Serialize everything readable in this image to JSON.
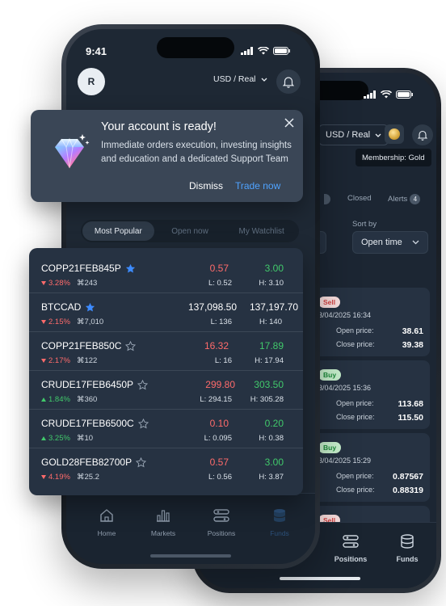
{
  "colors": {
    "accent": "#4fa3ff",
    "positive": "#41c96b",
    "negative": "#ff6b6b",
    "star_filled": "#3d8bff",
    "screen_bg": "#1e2834",
    "card_bg": "#263242"
  },
  "back_phone": {
    "account_selector": "USD / Real",
    "membership": "Membership: Gold",
    "tabs": [
      {
        "label": "Closed"
      },
      {
        "label": "Alerts",
        "count": "4"
      }
    ],
    "sort_label": "Sort by",
    "sort_value": "Open time",
    "positions": [
      {
        "side": "Sell",
        "date": "3/04/2025 16:34",
        "open_label": "Open price:",
        "open": "38.61",
        "close_label": "Close price:",
        "close": "39.38"
      },
      {
        "side": "Buy",
        "date": "3/04/2025 15:36",
        "open_label": "Open price:",
        "open": "113.68",
        "close_label": "Close price:",
        "close": "115.50"
      },
      {
        "side": "Buy",
        "date": "3/04/2025 15:29",
        "open_label": "Open price:",
        "open": "0.87567",
        "close_label": "Close price:",
        "close": "0.88319"
      },
      {
        "side": "Sell"
      }
    ],
    "nav": [
      {
        "label": "Positions",
        "icon": "positions-icon"
      },
      {
        "label": "Funds",
        "icon": "funds-icon"
      }
    ]
  },
  "front_phone": {
    "time": "9:41",
    "avatar_initial": "R",
    "account_selector": "USD / Real",
    "segments": [
      "Most Popular",
      "Open now",
      "My Watchlist"
    ],
    "active_segment": "Most Popular",
    "nav": [
      {
        "label": "Home",
        "icon": "home-icon"
      },
      {
        "label": "Markets",
        "icon": "markets-icon"
      },
      {
        "label": "Positions",
        "icon": "positions-icon"
      },
      {
        "label": "Funds",
        "icon": "funds-icon",
        "active": true
      }
    ]
  },
  "notification": {
    "title": "Your account is ready!",
    "body": "Immediate orders execution, investing insights and education and a dedicated Support Team",
    "dismiss": "Dismiss",
    "action": "Trade now"
  },
  "markets": [
    {
      "symbol": "COPP21FEB845P",
      "starred": true,
      "change": "3.28%",
      "direction": "down",
      "volume": "243",
      "bid": "0.57",
      "bid_color": "red",
      "ask": "3.00",
      "ask_color": "green",
      "low": "L: 0.52",
      "high": "H: 3.10"
    },
    {
      "symbol": "BTCCAD",
      "starred": true,
      "change": "2.15%",
      "direction": "down",
      "volume": "7,010",
      "bid": "137,098.50",
      "bid_color": "white",
      "ask": "137,197.70",
      "ask_color": "white",
      "low": "L: 136",
      "high": "H: 140"
    },
    {
      "symbol": "COPP21FEB850C",
      "starred": false,
      "change": "2.17%",
      "direction": "down",
      "volume": "122",
      "bid": "16.32",
      "bid_color": "red",
      "ask": "17.89",
      "ask_color": "green",
      "low": "L: 16",
      "high": "H: 17.94"
    },
    {
      "symbol": "CRUDE17FEB6450P",
      "starred": false,
      "change": "1.84%",
      "direction": "up",
      "volume": "360",
      "bid": "299.80",
      "bid_color": "red",
      "ask": "303.50",
      "ask_color": "green",
      "low": "L: 294.15",
      "high": "H: 305.28"
    },
    {
      "symbol": "CRUDE17FEB6500C",
      "starred": false,
      "change": "3.25%",
      "direction": "up",
      "volume": "10",
      "bid": "0.10",
      "bid_color": "red",
      "ask": "0.20",
      "ask_color": "green",
      "low": "L: 0.095",
      "high": "H: 0.38"
    },
    {
      "symbol": "GOLD28FEB82700P",
      "starred": false,
      "change": "4.19%",
      "direction": "down",
      "volume": "25.2",
      "bid": "0.57",
      "bid_color": "red",
      "ask": "3.00",
      "ask_color": "green",
      "low": "L: 0.56",
      "high": "H: 3.87"
    }
  ]
}
